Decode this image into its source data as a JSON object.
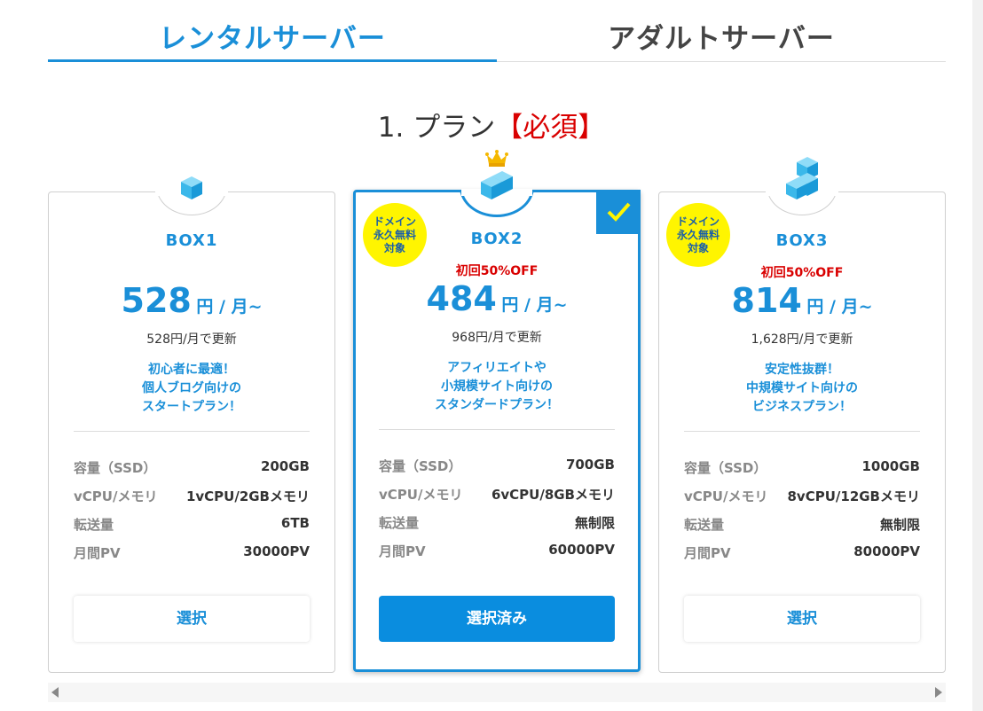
{
  "tabs": {
    "rental": "レンタルサーバー",
    "adult": "アダルトサーバー"
  },
  "section": {
    "title": "1. プラン",
    "required": "【必須】"
  },
  "plans": [
    {
      "name": "BOX1",
      "discount": "",
      "price": "528",
      "price_unit": "円 / 月~",
      "renew": "528円/月で更新",
      "desc": [
        "初心者に最適！",
        "個人ブログ向けの",
        "スタートプラン！"
      ],
      "badge": [],
      "specs": [
        {
          "k": "容量（SSD）",
          "v": "200GB"
        },
        {
          "k": "vCPU/メモリ",
          "v": "1vCPU/2GBメモリ"
        },
        {
          "k": "転送量",
          "v": "6TB"
        },
        {
          "k": "月間PV",
          "v": "30000PV"
        }
      ],
      "button": "選択"
    },
    {
      "name": "BOX2",
      "discount": "初回50%OFF",
      "price": "484",
      "price_unit": "円 / 月~",
      "renew": "968円/月で更新",
      "desc": [
        "アフィリエイトや",
        "小規模サイト向けの",
        "スタンダードプラン！"
      ],
      "badge": [
        "ドメイン",
        "永久無料",
        "対象"
      ],
      "specs": [
        {
          "k": "容量（SSD）",
          "v": "700GB"
        },
        {
          "k": "vCPU/メモリ",
          "v": "6vCPU/8GBメモリ"
        },
        {
          "k": "転送量",
          "v": "無制限"
        },
        {
          "k": "月間PV",
          "v": "60000PV"
        }
      ],
      "button": "選択済み"
    },
    {
      "name": "BOX3",
      "discount": "初回50%OFF",
      "price": "814",
      "price_unit": "円 / 月~",
      "renew": "1,628円/月で更新",
      "desc": [
        "安定性抜群！",
        "中規模サイト向けの",
        "ビジネスプラン！"
      ],
      "badge": [
        "ドメイン",
        "永久無料",
        "対象"
      ],
      "specs": [
        {
          "k": "容量（SSD）",
          "v": "1000GB"
        },
        {
          "k": "vCPU/メモリ",
          "v": "8vCPU/12GBメモリ"
        },
        {
          "k": "転送量",
          "v": "無制限"
        },
        {
          "k": "月間PV",
          "v": "80000PV"
        }
      ],
      "button": "選択"
    }
  ],
  "colors": {
    "accent": "#1a8fd8",
    "required_red": "#d90000",
    "badge_yellow": "#fff500"
  }
}
